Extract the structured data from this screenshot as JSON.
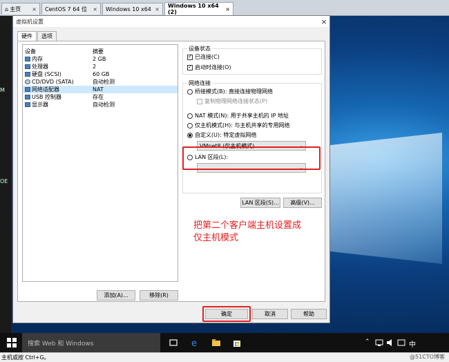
{
  "browser_tabs": [
    {
      "label": "主页",
      "active": false
    },
    {
      "label": "CentOS 7 64 位",
      "active": false
    },
    {
      "label": "Windows 10 x64",
      "active": false
    },
    {
      "label": "Windows 10 x64 (2)",
      "active": true
    }
  ],
  "dialog": {
    "title": "虚拟机设置",
    "tabs": [
      "硬件",
      "选项"
    ],
    "device_table": {
      "headers": [
        "设备",
        "摘要"
      ],
      "rows": [
        {
          "device": "内存",
          "summary": "2 GB"
        },
        {
          "device": "处理器",
          "summary": "2"
        },
        {
          "device": "硬盘 (SCSI)",
          "summary": "60 GB"
        },
        {
          "device": "CD/DVD (SATA)",
          "summary": "自动检测"
        },
        {
          "device": "网络适配器",
          "summary": "NAT"
        },
        {
          "device": "USB 控制器",
          "summary": "存在"
        },
        {
          "device": "显示器",
          "summary": "自动检测"
        }
      ]
    },
    "add_button": "添加(A)...",
    "remove_button": "移除(R)",
    "device_status": {
      "title": "设备状态",
      "connected": "已连接(C)",
      "connect_on_power": "启动时连接(O)"
    },
    "network": {
      "title": "网络连接",
      "bridged": "桥接模式(B): 直接连接物理网络",
      "replicate": "复制物理网络连接状态(P)",
      "nat": "NAT 模式(N): 用于共享主机的 IP 地址",
      "host_only": "仅主机模式(H): 与主机共享的专用网络",
      "custom": "自定义(U): 特定虚拟网络",
      "custom_value": "VMnet8 (仅主机模式)",
      "lan": "LAN 区段(L):",
      "lan_value": ""
    },
    "lan_segments_button": "LAN 区段(S)...",
    "advanced_button": "高级(V)...",
    "ok_button": "确定",
    "cancel_button": "取消",
    "help_button": "帮助"
  },
  "annotation": {
    "line1": "把第二个客户端主机设置成",
    "line2": "仅主机模式"
  },
  "taskbar": {
    "search_placeholder": "搜索 Web 和 Windows",
    "ime": "中"
  },
  "statusbar": {
    "text": "主机或按 Ctrl+G。"
  },
  "watermark": "@51CTO博客",
  "side_labels": [
    "M",
    "OE"
  ],
  "colors": {
    "annotation": "#e02020",
    "selection": "#cde8ff"
  }
}
